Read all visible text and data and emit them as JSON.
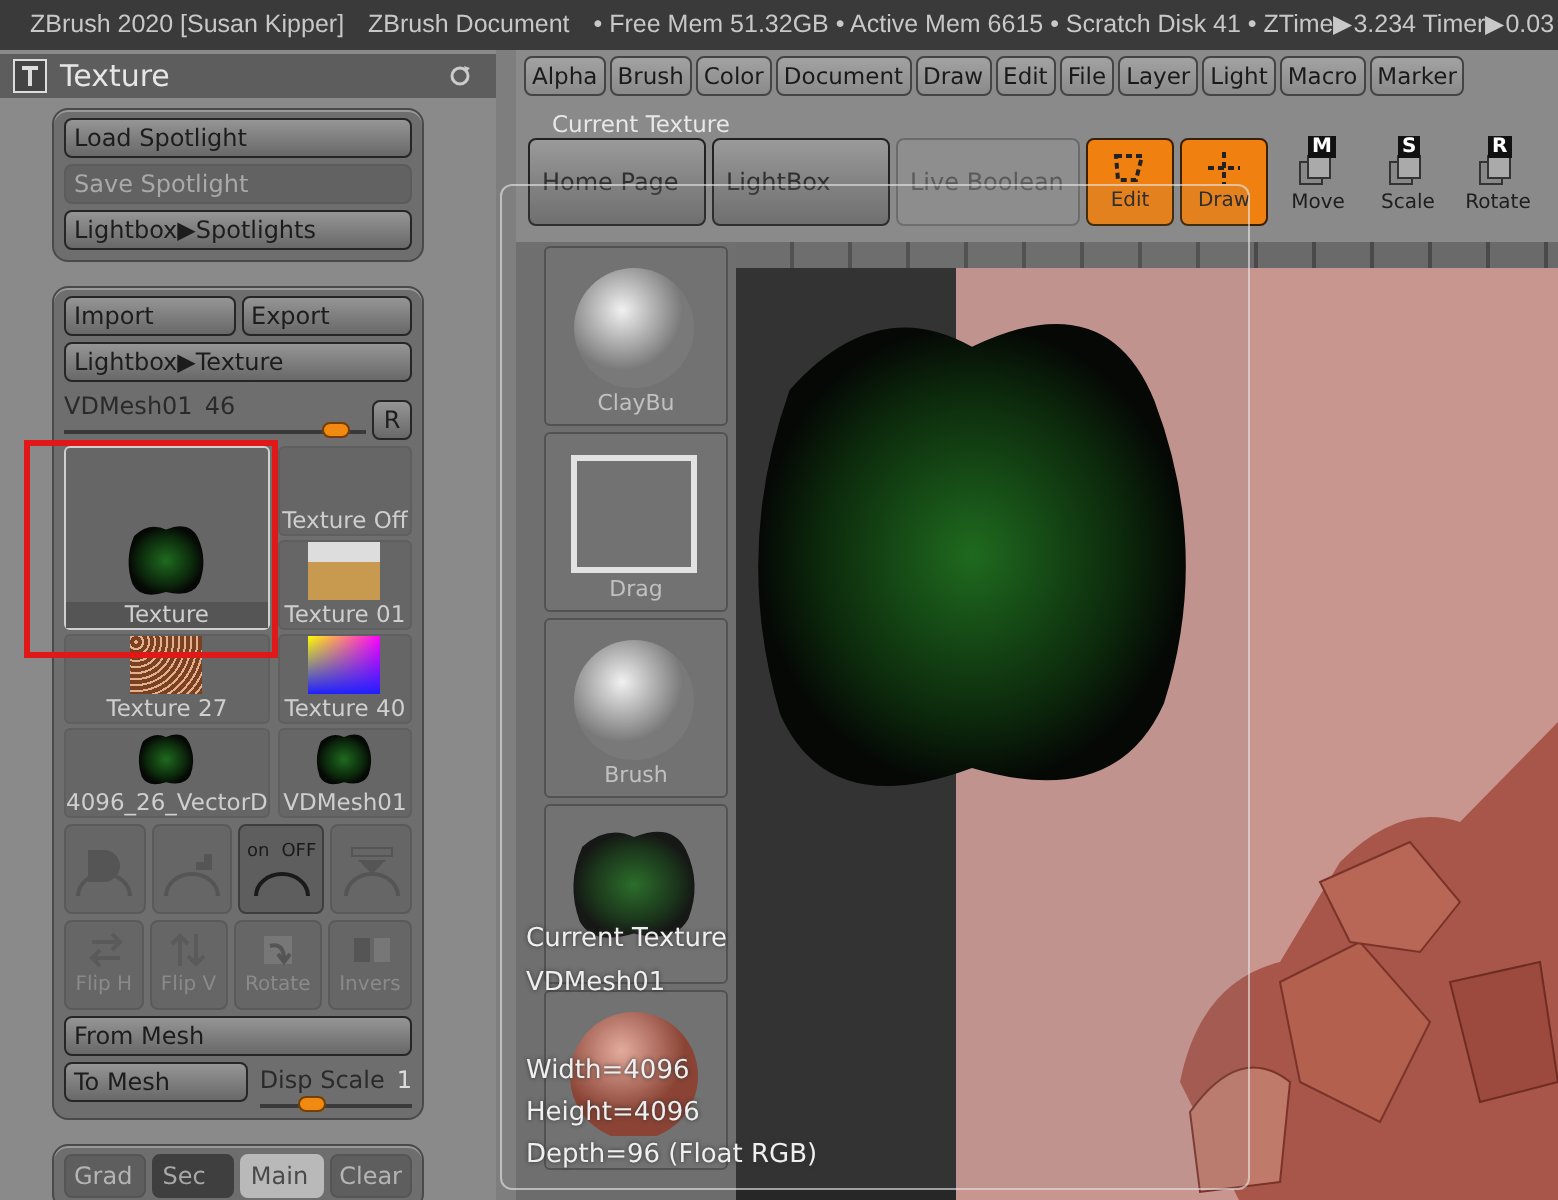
{
  "title_bar": {
    "app": "ZBrush 2020 [Susan Kipper]",
    "document": "ZBrush Document",
    "status": "• Free Mem 51.32GB • Active Mem 6615 • Scratch Disk 41 •  ZTime▶3.234 Timer▶0.03"
  },
  "palette": {
    "title": "Texture",
    "spotlight_buttons": [
      {
        "label": "Load Spotlight",
        "disabled": false
      },
      {
        "label": "Save Spotlight",
        "disabled": true
      },
      {
        "label": "Lightbox▶Spotlights",
        "disabled": false
      }
    ],
    "import_export": [
      "Import",
      "Export"
    ],
    "lightbox_button": "Lightbox▶Texture",
    "slider": {
      "label": "VDMesh01",
      "value": "46",
      "level": 0.95,
      "reset": "R"
    },
    "textures": [
      {
        "label": "Texture Off",
        "kind": "none",
        "selected": false,
        "highlighted": false
      },
      {
        "label": "Texture",
        "kind": "blob",
        "selected": true,
        "highlighted": true
      },
      {
        "label": "Texture 01",
        "kind": "photo",
        "selected": false,
        "highlighted": false
      },
      {
        "label": "Texture 27",
        "kind": "noise",
        "selected": false,
        "highlighted": false
      },
      {
        "label": "Texture 40",
        "kind": "spectrum",
        "selected": false,
        "highlighted": false
      },
      {
        "label": "4096_26_VectorD",
        "kind": "blob",
        "selected": false,
        "highlighted": false
      },
      {
        "label": "VDMesh01",
        "kind": "blob",
        "selected": false,
        "highlighted": false
      }
    ],
    "icon_buttons": [
      {
        "kind": "gradient",
        "disabled": true
      },
      {
        "kind": "antialias",
        "disabled": true
      },
      {
        "kind": "onoff",
        "on_label": "on",
        "off_label": "OFF",
        "disabled": false
      },
      {
        "kind": "levels",
        "disabled": true
      }
    ],
    "transform_buttons": [
      {
        "label": "Flip H",
        "kind": "flip-h",
        "disabled": true
      },
      {
        "label": "Flip V",
        "kind": "flip-v",
        "disabled": true
      },
      {
        "label": "Rotate",
        "kind": "rotate",
        "disabled": true
      },
      {
        "label": "Invers",
        "kind": "invert",
        "disabled": true
      }
    ],
    "from_mesh": "From Mesh",
    "to_mesh": "To Mesh",
    "disp_scale": {
      "label": "Disp Scale",
      "value": "1",
      "level": 0.35
    },
    "color_buttons": [
      {
        "label": "Grad",
        "kind": "gradient"
      },
      {
        "label": "Sec",
        "kind": "swatch",
        "color": "#3f3f3f"
      },
      {
        "label": "Main",
        "kind": "swatch",
        "color": "#b9b9b9"
      },
      {
        "label": "Clear",
        "kind": "clear"
      }
    ]
  },
  "menu": [
    "Alpha",
    "Brush",
    "Color",
    "Document",
    "Draw",
    "Edit",
    "File",
    "Layer",
    "Light",
    "Macro",
    "Marker"
  ],
  "shelf_title": "Current Texture",
  "toolbar": [
    {
      "label": "Home Page",
      "kind": "button"
    },
    {
      "label": "LightBox",
      "kind": "button"
    },
    {
      "label": "Live Boolean",
      "kind": "toggle",
      "on": false
    },
    {
      "label": "Edit",
      "kind": "mode",
      "on": true
    },
    {
      "label": "Draw",
      "kind": "mode",
      "on": true
    },
    {
      "label": "Move",
      "kind": "transform",
      "key": "M"
    },
    {
      "label": "Scale",
      "kind": "transform",
      "key": "S"
    },
    {
      "label": "Rotate",
      "kind": "transform",
      "key": "R"
    }
  ],
  "shelf": [
    {
      "label": "ClayBu",
      "kind": "sphere"
    },
    {
      "label": "Drag",
      "kind": "rect"
    },
    {
      "label": "Brush",
      "kind": "sphere"
    },
    {
      "kind": "texture"
    },
    {
      "kind": "matcap"
    }
  ],
  "popup": {
    "title": "Current Texture",
    "name": "VDMesh01",
    "details": [
      "Width=4096",
      "Height=4096",
      "Depth=96 (Float RGB)"
    ]
  }
}
